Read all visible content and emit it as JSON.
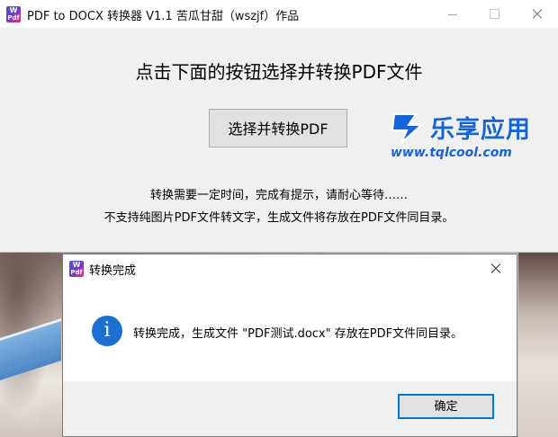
{
  "main_window": {
    "title": "PDF to DOCX 转换器 V1.1 苦瓜甘甜（wszjf）作品",
    "icon": "app-icon",
    "icon_letters_top": "W",
    "icon_letters_bottom": "Pdf",
    "headline": "点击下面的按钮选择并转换PDF文件",
    "convert_button": "选择并转换PDF",
    "info_line1": "转换需要一定时间，完成有提示，请耐心等待……",
    "info_line2": "不支持纯图片PDF文件转文字，生成文件将存放在PDF文件同目录。",
    "controls": [
      "minimize-icon",
      "maximize-icon",
      "close-icon"
    ]
  },
  "watermark": {
    "name": "乐享应用",
    "url": "www.tqlcool.com",
    "color": "#1565d8"
  },
  "dialog": {
    "title": "转换完成",
    "icon": "info-icon",
    "info_glyph": "i",
    "message": "转换完成，生成文件 \"PDF测试.docx\" 存放在PDF文件同目录。",
    "ok_button": "确定",
    "accent": "#0078d7"
  }
}
